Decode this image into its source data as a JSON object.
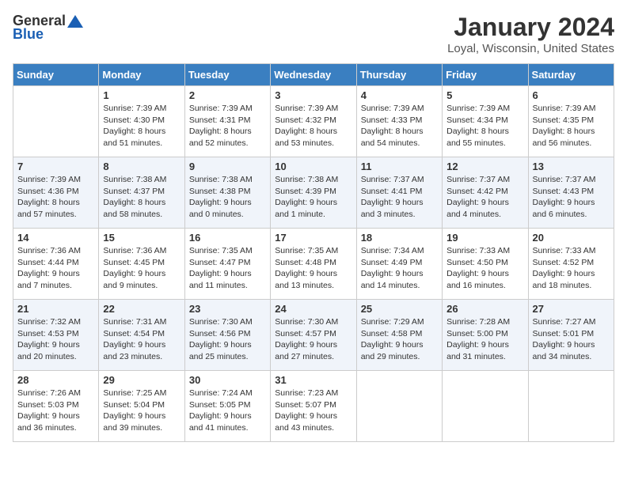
{
  "header": {
    "logo_general": "General",
    "logo_blue": "Blue",
    "title": "January 2024",
    "subtitle": "Loyal, Wisconsin, United States"
  },
  "days_of_week": [
    "Sunday",
    "Monday",
    "Tuesday",
    "Wednesday",
    "Thursday",
    "Friday",
    "Saturday"
  ],
  "weeks": [
    [
      {
        "day": "",
        "info": ""
      },
      {
        "day": "1",
        "info": "Sunrise: 7:39 AM\nSunset: 4:30 PM\nDaylight: 8 hours\nand 51 minutes."
      },
      {
        "day": "2",
        "info": "Sunrise: 7:39 AM\nSunset: 4:31 PM\nDaylight: 8 hours\nand 52 minutes."
      },
      {
        "day": "3",
        "info": "Sunrise: 7:39 AM\nSunset: 4:32 PM\nDaylight: 8 hours\nand 53 minutes."
      },
      {
        "day": "4",
        "info": "Sunrise: 7:39 AM\nSunset: 4:33 PM\nDaylight: 8 hours\nand 54 minutes."
      },
      {
        "day": "5",
        "info": "Sunrise: 7:39 AM\nSunset: 4:34 PM\nDaylight: 8 hours\nand 55 minutes."
      },
      {
        "day": "6",
        "info": "Sunrise: 7:39 AM\nSunset: 4:35 PM\nDaylight: 8 hours\nand 56 minutes."
      }
    ],
    [
      {
        "day": "7",
        "info": "Sunrise: 7:39 AM\nSunset: 4:36 PM\nDaylight: 8 hours\nand 57 minutes."
      },
      {
        "day": "8",
        "info": "Sunrise: 7:38 AM\nSunset: 4:37 PM\nDaylight: 8 hours\nand 58 minutes."
      },
      {
        "day": "9",
        "info": "Sunrise: 7:38 AM\nSunset: 4:38 PM\nDaylight: 9 hours\nand 0 minutes."
      },
      {
        "day": "10",
        "info": "Sunrise: 7:38 AM\nSunset: 4:39 PM\nDaylight: 9 hours\nand 1 minute."
      },
      {
        "day": "11",
        "info": "Sunrise: 7:37 AM\nSunset: 4:41 PM\nDaylight: 9 hours\nand 3 minutes."
      },
      {
        "day": "12",
        "info": "Sunrise: 7:37 AM\nSunset: 4:42 PM\nDaylight: 9 hours\nand 4 minutes."
      },
      {
        "day": "13",
        "info": "Sunrise: 7:37 AM\nSunset: 4:43 PM\nDaylight: 9 hours\nand 6 minutes."
      }
    ],
    [
      {
        "day": "14",
        "info": "Sunrise: 7:36 AM\nSunset: 4:44 PM\nDaylight: 9 hours\nand 7 minutes."
      },
      {
        "day": "15",
        "info": "Sunrise: 7:36 AM\nSunset: 4:45 PM\nDaylight: 9 hours\nand 9 minutes."
      },
      {
        "day": "16",
        "info": "Sunrise: 7:35 AM\nSunset: 4:47 PM\nDaylight: 9 hours\nand 11 minutes."
      },
      {
        "day": "17",
        "info": "Sunrise: 7:35 AM\nSunset: 4:48 PM\nDaylight: 9 hours\nand 13 minutes."
      },
      {
        "day": "18",
        "info": "Sunrise: 7:34 AM\nSunset: 4:49 PM\nDaylight: 9 hours\nand 14 minutes."
      },
      {
        "day": "19",
        "info": "Sunrise: 7:33 AM\nSunset: 4:50 PM\nDaylight: 9 hours\nand 16 minutes."
      },
      {
        "day": "20",
        "info": "Sunrise: 7:33 AM\nSunset: 4:52 PM\nDaylight: 9 hours\nand 18 minutes."
      }
    ],
    [
      {
        "day": "21",
        "info": "Sunrise: 7:32 AM\nSunset: 4:53 PM\nDaylight: 9 hours\nand 20 minutes."
      },
      {
        "day": "22",
        "info": "Sunrise: 7:31 AM\nSunset: 4:54 PM\nDaylight: 9 hours\nand 23 minutes."
      },
      {
        "day": "23",
        "info": "Sunrise: 7:30 AM\nSunset: 4:56 PM\nDaylight: 9 hours\nand 25 minutes."
      },
      {
        "day": "24",
        "info": "Sunrise: 7:30 AM\nSunset: 4:57 PM\nDaylight: 9 hours\nand 27 minutes."
      },
      {
        "day": "25",
        "info": "Sunrise: 7:29 AM\nSunset: 4:58 PM\nDaylight: 9 hours\nand 29 minutes."
      },
      {
        "day": "26",
        "info": "Sunrise: 7:28 AM\nSunset: 5:00 PM\nDaylight: 9 hours\nand 31 minutes."
      },
      {
        "day": "27",
        "info": "Sunrise: 7:27 AM\nSunset: 5:01 PM\nDaylight: 9 hours\nand 34 minutes."
      }
    ],
    [
      {
        "day": "28",
        "info": "Sunrise: 7:26 AM\nSunset: 5:03 PM\nDaylight: 9 hours\nand 36 minutes."
      },
      {
        "day": "29",
        "info": "Sunrise: 7:25 AM\nSunset: 5:04 PM\nDaylight: 9 hours\nand 39 minutes."
      },
      {
        "day": "30",
        "info": "Sunrise: 7:24 AM\nSunset: 5:05 PM\nDaylight: 9 hours\nand 41 minutes."
      },
      {
        "day": "31",
        "info": "Sunrise: 7:23 AM\nSunset: 5:07 PM\nDaylight: 9 hours\nand 43 minutes."
      },
      {
        "day": "",
        "info": ""
      },
      {
        "day": "",
        "info": ""
      },
      {
        "day": "",
        "info": ""
      }
    ]
  ]
}
